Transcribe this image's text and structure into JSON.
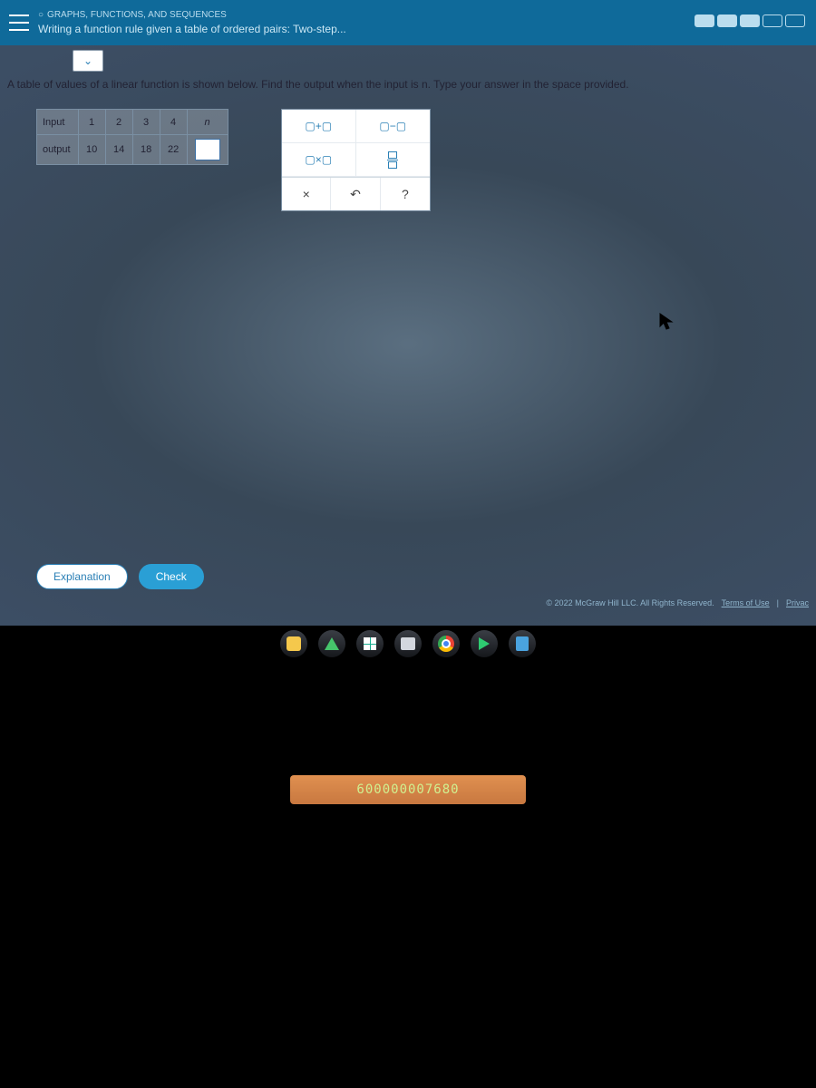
{
  "header": {
    "category_icon": "○",
    "category": "GRAPHS, FUNCTIONS, AND SEQUENCES",
    "title": "Writing a function rule given a table of ordered pairs: Two-step..."
  },
  "progress": {
    "segments": [
      true,
      true,
      true,
      false,
      false
    ]
  },
  "instruction": "A table of values of a linear function is shown below. Find the output when the input is n. Type your answer in the space provided.",
  "table": {
    "row1_label": "Input",
    "row2_label": "output",
    "inputs": [
      "1",
      "2",
      "3",
      "4",
      "n"
    ],
    "outputs": [
      "10",
      "14",
      "18",
      "22"
    ]
  },
  "keypad": {
    "plus": "▢+▢",
    "minus": "▢−▢",
    "times": "▢×▢",
    "clear": "×",
    "undo": "↶",
    "help": "?"
  },
  "buttons": {
    "explanation": "Explanation",
    "check": "Check"
  },
  "footer": {
    "copyright": "© 2022 McGraw Hill LLC. All Rights Reserved.",
    "terms": "Terms of Use",
    "privacy": "Privac"
  },
  "watermark": "600000007680"
}
